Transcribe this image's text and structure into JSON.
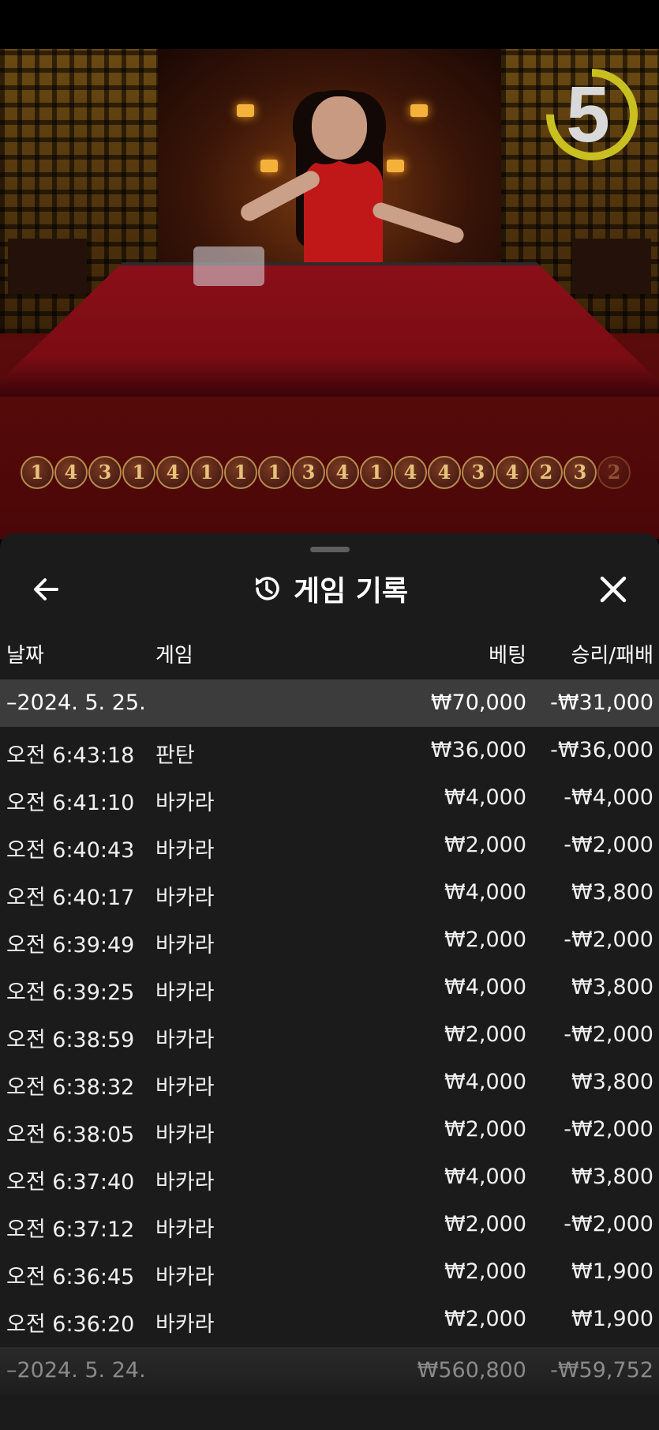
{
  "video": {
    "timer_value": "5",
    "timer_progress": 0.75,
    "bead_road": [
      "1",
      "4",
      "3",
      "1",
      "4",
      "1",
      "1",
      "1",
      "3",
      "4",
      "1",
      "4",
      "4",
      "3",
      "4",
      "2",
      "3",
      "2"
    ]
  },
  "sheet": {
    "title": "게임 기록",
    "back_icon": "arrow-left-icon",
    "title_icon": "history-icon",
    "close_icon": "close-icon",
    "columns": {
      "date": "날짜",
      "game": "게임",
      "bet": "베팅",
      "result": "승리/패배"
    },
    "groups": [
      {
        "date": "–2024. 5. 25.",
        "bet": "₩70,000",
        "result": "-₩31,000",
        "rows": [
          {
            "time": "오전 6:43:18",
            "game": "판탄",
            "bet": "₩36,000",
            "result": "-₩36,000"
          },
          {
            "time": "오전 6:41:10",
            "game": "바카라",
            "bet": "₩4,000",
            "result": "-₩4,000"
          },
          {
            "time": "오전 6:40:43",
            "game": "바카라",
            "bet": "₩2,000",
            "result": "-₩2,000"
          },
          {
            "time": "오전 6:40:17",
            "game": "바카라",
            "bet": "₩4,000",
            "result": "₩3,800"
          },
          {
            "time": "오전 6:39:49",
            "game": "바카라",
            "bet": "₩2,000",
            "result": "-₩2,000"
          },
          {
            "time": "오전 6:39:25",
            "game": "바카라",
            "bet": "₩4,000",
            "result": "₩3,800"
          },
          {
            "time": "오전 6:38:59",
            "game": "바카라",
            "bet": "₩2,000",
            "result": "-₩2,000"
          },
          {
            "time": "오전 6:38:32",
            "game": "바카라",
            "bet": "₩4,000",
            "result": "₩3,800"
          },
          {
            "time": "오전 6:38:05",
            "game": "바카라",
            "bet": "₩2,000",
            "result": "-₩2,000"
          },
          {
            "time": "오전 6:37:40",
            "game": "바카라",
            "bet": "₩4,000",
            "result": "₩3,800"
          },
          {
            "time": "오전 6:37:12",
            "game": "바카라",
            "bet": "₩2,000",
            "result": "-₩2,000"
          },
          {
            "time": "오전 6:36:45",
            "game": "바카라",
            "bet": "₩2,000",
            "result": "₩1,900"
          },
          {
            "time": "오전 6:36:20",
            "game": "바카라",
            "bet": "₩2,000",
            "result": "₩1,900"
          }
        ]
      },
      {
        "date": "–2024. 5. 24.",
        "bet": "₩560,800",
        "result": "-₩59,752",
        "rows": []
      }
    ]
  }
}
